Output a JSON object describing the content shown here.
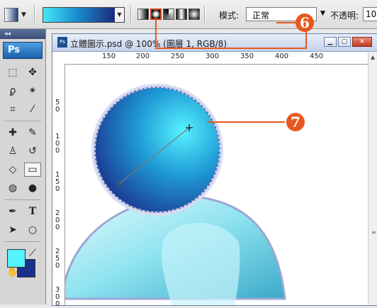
{
  "options_bar": {
    "mode_label": "模式:",
    "mode_value": "正常",
    "opacity_label": "不透明:",
    "opacity_value": "10",
    "gradient_colors": [
      "#46e6f4",
      "#1a8fd0",
      "#1a2a78"
    ],
    "selected_gradient_type": "radial"
  },
  "document": {
    "title": "立體圖示.psd @ 100% (圖層 1, RGB/8)",
    "icon_text": "Ps",
    "ruler_top": [
      "150",
      "200",
      "250",
      "300",
      "350",
      "400",
      "450"
    ],
    "ruler_left": [
      "50",
      "100",
      "150",
      "200",
      "250",
      "300"
    ]
  },
  "toolbox": {
    "logo": "Ps",
    "collapse": "◂◂",
    "foreground_color": "#55f2ff",
    "background_color": "#1a2f8a"
  },
  "callouts": {
    "six": "6",
    "seven": "7"
  },
  "colors": {
    "accent": "#e8571e",
    "sphere_light": "#55f2ff",
    "sphere_dark": "#1a2f8a"
  }
}
